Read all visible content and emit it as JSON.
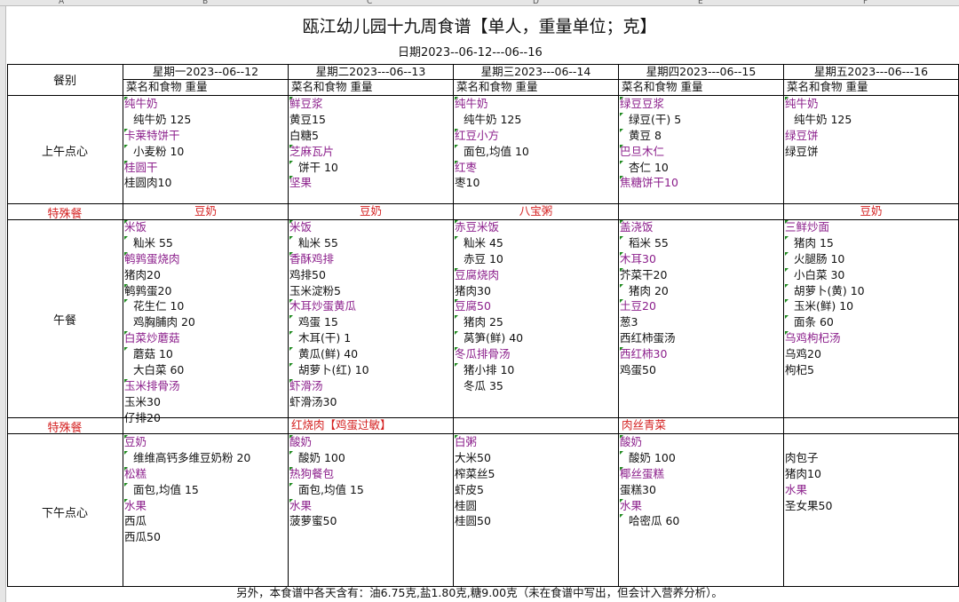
{
  "spreadsheet": {
    "column_letters": [
      "A",
      "B",
      "C",
      "D",
      "E",
      "F"
    ]
  },
  "header": {
    "title": "瓯江幼儿园十九周食谱【单人，重量单位；克】",
    "date": "日期2023--06-12---06--16"
  },
  "table": {
    "meal_label": "餐别",
    "days": [
      "星期一2023--06--12",
      "星期二2023---06--13",
      "星期三2023---06--14",
      "星期四2023---06--15",
      "星期五2023---06---16"
    ],
    "subheader": "菜名和食物    重量",
    "rows": {
      "morning": "上午点心",
      "special1": "特殊餐",
      "lunch": "午餐",
      "special2": "特殊餐",
      "afternoon": "下午点心"
    },
    "special1": [
      "豆奶",
      "豆奶",
      "八宝粥",
      "",
      "豆奶"
    ],
    "special2": [
      "",
      "红烧肉【鸡蛋过敏】",
      "",
      "肉丝青菜",
      ""
    ],
    "morning": [
      [
        {
          "t": "纯牛奶",
          "k": "dish",
          "m": true
        },
        {
          "t": "纯牛奶  125",
          "k": "ing",
          "i": true
        },
        {
          "t": "卡莱特饼干",
          "k": "dish",
          "m": true
        },
        {
          "t": "小麦粉  10",
          "k": "ing",
          "i": true,
          "m": true
        },
        {
          "t": "桂圆干",
          "k": "dish",
          "m": true
        },
        {
          "t": "桂圆肉10",
          "k": "ing"
        }
      ],
      [
        {
          "t": "鲜豆浆",
          "k": "dish",
          "m": true
        },
        {
          "t": "黄豆15",
          "k": "ing"
        },
        {
          "t": "白糖5",
          "k": "ing"
        },
        {
          "t": "芝麻瓦片",
          "k": "dish",
          "m": true
        },
        {
          "t": "饼干  10",
          "k": "ing",
          "i": true,
          "m": true
        },
        {
          "t": "坚果",
          "k": "dish",
          "m": true
        }
      ],
      [
        {
          "t": "纯牛奶",
          "k": "dish",
          "m": true
        },
        {
          "t": "纯牛奶  125",
          "k": "ing",
          "i": true
        },
        {
          "t": "红豆小方",
          "k": "dish",
          "m": true
        },
        {
          "t": "面包,均值  10",
          "k": "ing",
          "i": true,
          "m": true
        },
        {
          "t": "红枣",
          "k": "dish",
          "m": true
        },
        {
          "t": "枣10",
          "k": "ing"
        }
      ],
      [
        {
          "t": "绿豆豆浆",
          "k": "dish",
          "m": true
        },
        {
          "t": "绿豆(干)  5",
          "k": "ing",
          "i": true,
          "m": true
        },
        {
          "t": "黄豆  8",
          "k": "ing",
          "i": true,
          "m": true
        },
        {
          "t": "巴旦木仁",
          "k": "dish",
          "m": true
        },
        {
          "t": "杏仁  10",
          "k": "ing",
          "i": true,
          "m": true
        },
        {
          "t": "焦糖饼干10",
          "k": "dish",
          "m": true
        }
      ],
      [
        {
          "t": "纯牛奶",
          "k": "dish",
          "m": true
        },
        {
          "t": "纯牛奶  125",
          "k": "ing",
          "i": true
        },
        {
          "t": "绿豆饼",
          "k": "dish"
        },
        {
          "t": "绿豆饼",
          "k": "ing"
        }
      ]
    ],
    "lunch": [
      [
        {
          "t": "米饭",
          "k": "dish",
          "m": true
        },
        {
          "t": "籼米  55",
          "k": "ing",
          "i": true,
          "m": true
        },
        {
          "t": "鹌鹑蛋烧肉",
          "k": "dish",
          "m": true
        },
        {
          "t": "猪肉20",
          "k": "ing"
        },
        {
          "t": "鹌鹑蛋20",
          "k": "ing",
          "m": true
        },
        {
          "t": "花生仁  10",
          "k": "ing",
          "i": true,
          "m": true
        },
        {
          "t": "鸡胸脯肉  20",
          "k": "ing",
          "i": true
        },
        {
          "t": "白菜炒蘑菇",
          "k": "dish",
          "m": true
        },
        {
          "t": "蘑菇  10",
          "k": "ing",
          "i": true,
          "m": true
        },
        {
          "t": "大白菜  60",
          "k": "ing",
          "i": true
        },
        {
          "t": "玉米排骨汤",
          "k": "dish",
          "m": true
        },
        {
          "t": "玉米30",
          "k": "ing"
        },
        {
          "t": "仔排20",
          "k": "ing"
        }
      ],
      [
        {
          "t": "米饭",
          "k": "dish",
          "m": true
        },
        {
          "t": "籼米  55",
          "k": "ing",
          "i": true,
          "m": true
        },
        {
          "t": "香酥鸡排",
          "k": "dish",
          "m": true
        },
        {
          "t": "鸡排50",
          "k": "ing"
        },
        {
          "t": "玉米淀粉5",
          "k": "ing"
        },
        {
          "t": "木耳炒蛋黄瓜",
          "k": "dish",
          "m": true
        },
        {
          "t": "鸡蛋  15",
          "k": "ing",
          "i": true,
          "m": true
        },
        {
          "t": "木耳(干)  1",
          "k": "ing",
          "i": true,
          "m": true
        },
        {
          "t": "黄瓜(鲜)  40",
          "k": "ing",
          "i": true,
          "m": true
        },
        {
          "t": "胡萝卜(红)  10",
          "k": "ing",
          "i": true,
          "m": true
        },
        {
          "t": "虾滑汤",
          "k": "dish",
          "m": true
        },
        {
          "t": "虾滑汤30",
          "k": "ing"
        }
      ],
      [
        {
          "t": "赤豆米饭",
          "k": "dish",
          "m": true
        },
        {
          "t": "籼米  45",
          "k": "ing",
          "i": true,
          "m": true
        },
        {
          "t": "赤豆  10",
          "k": "ing",
          "i": true
        },
        {
          "t": "豆腐烧肉",
          "k": "dish",
          "m": true
        },
        {
          "t": "猪肉30",
          "k": "ing"
        },
        {
          "t": "豆腐50",
          "k": "dish",
          "m": true
        },
        {
          "t": "猪肉  25",
          "k": "ing",
          "i": true,
          "m": true
        },
        {
          "t": "莴笋(鲜)  40",
          "k": "ing",
          "i": true,
          "m": true
        },
        {
          "t": "冬瓜排骨汤",
          "k": "dish",
          "m": true
        },
        {
          "t": "猪小排  10",
          "k": "ing",
          "i": true,
          "m": true
        },
        {
          "t": "冬瓜  35",
          "k": "ing",
          "i": true
        }
      ],
      [
        {
          "t": "盖浇饭",
          "k": "dish",
          "m": true
        },
        {
          "t": "稻米  55",
          "k": "ing",
          "i": true,
          "m": true
        },
        {
          "t": "木耳30",
          "k": "dish",
          "m": true
        },
        {
          "t": "芥菜干20",
          "k": "ing",
          "m": true
        },
        {
          "t": "猪肉  20",
          "k": "ing",
          "i": true,
          "m": true
        },
        {
          "t": "土豆20",
          "k": "dish",
          "m": true
        },
        {
          "t": "葱3",
          "k": "ing"
        },
        {
          "t": "西红柿蛋汤",
          "k": "ing"
        },
        {
          "t": "西红柿30",
          "k": "dish",
          "m": true
        },
        {
          "t": "鸡蛋50",
          "k": "ing"
        }
      ],
      [
        {
          "t": "三鲜炒面",
          "k": "dish",
          "m": true
        },
        {
          "t": "猪肉  15",
          "k": "ing",
          "i": true,
          "m": true
        },
        {
          "t": "火腿肠  10",
          "k": "ing",
          "i": true,
          "m": true
        },
        {
          "t": "小白菜  30",
          "k": "ing",
          "i": true,
          "m": true
        },
        {
          "t": "胡萝卜(黄)  10",
          "k": "ing",
          "i": true,
          "m": true
        },
        {
          "t": "玉米(鲜)  10",
          "k": "ing",
          "i": true,
          "m": true
        },
        {
          "t": "面条  60",
          "k": "ing",
          "i": true,
          "m": true
        },
        {
          "t": "乌鸡枸杞汤",
          "k": "dish",
          "m": true
        },
        {
          "t": "乌鸡20",
          "k": "ing"
        },
        {
          "t": "枸杞5",
          "k": "ing"
        }
      ]
    ],
    "afternoon": [
      [
        {
          "t": "豆奶",
          "k": "dish",
          "m": true
        },
        {
          "t": "维维高钙多维豆奶粉  20",
          "k": "ing",
          "i": true,
          "m": true
        },
        {
          "t": "松糕",
          "k": "dish",
          "m": true
        },
        {
          "t": "面包,均值  15",
          "k": "ing",
          "i": true,
          "m": true
        },
        {
          "t": "水果",
          "k": "dish",
          "m": true
        },
        {
          "t": "西瓜",
          "k": "ing"
        },
        {
          "t": "西瓜50",
          "k": "ing"
        }
      ],
      [
        {
          "t": "酸奶",
          "k": "dish",
          "m": true
        },
        {
          "t": "酸奶  100",
          "k": "ing",
          "i": true,
          "m": true
        },
        {
          "t": "热狗餐包",
          "k": "dish",
          "m": true
        },
        {
          "t": "面包,均值  15",
          "k": "ing",
          "i": true,
          "m": true
        },
        {
          "t": "水果",
          "k": "dish",
          "m": true
        },
        {
          "t": "菠萝蜜50",
          "k": "ing"
        }
      ],
      [
        {
          "t": "白粥",
          "k": "dish",
          "m": true
        },
        {
          "t": "大米50",
          "k": "ing"
        },
        {
          "t": "榨菜丝5",
          "k": "ing"
        },
        {
          "t": "虾皮5",
          "k": "ing"
        },
        {
          "t": "桂圆",
          "k": "ing"
        },
        {
          "t": "桂圆50",
          "k": "ing"
        }
      ],
      [
        {
          "t": "酸奶",
          "k": "dish",
          "m": true
        },
        {
          "t": "酸奶  100",
          "k": "ing",
          "i": true,
          "m": true
        },
        {
          "t": "椰丝蛋糕",
          "k": "dish",
          "m": true
        },
        {
          "t": "蛋糕30",
          "k": "ing"
        },
        {
          "t": "水果",
          "k": "dish",
          "m": true
        },
        {
          "t": "哈密瓜  60",
          "k": "ing",
          "i": true,
          "m": true
        }
      ],
      [
        {
          "t": "",
          "k": "ing"
        },
        {
          "t": "肉包子",
          "k": "ing"
        },
        {
          "t": "猪肉10",
          "k": "ing"
        },
        {
          "t": "水果",
          "k": "dish"
        },
        {
          "t": "圣女果50",
          "k": "ing"
        }
      ]
    ]
  },
  "footer": "另外，本食谱中各天含有：油6.75克,盐1.80克,糖9.00克（未在食谱中写出，但会计入营养分析）。",
  "colors": {
    "dish": "#8b1e8b",
    "special": "#d42020",
    "marker": "#1f8a1f",
    "header_bg": "#e6e6e6"
  }
}
